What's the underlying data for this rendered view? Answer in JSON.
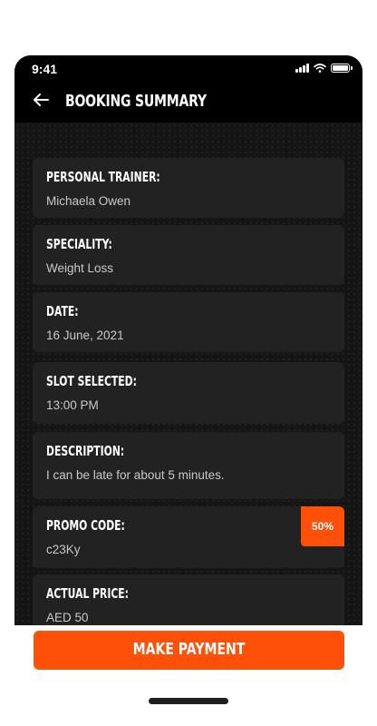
{
  "status_bar": {
    "time": "9:41"
  },
  "header": {
    "title": "BOOKING SUMMARY"
  },
  "summary": [
    {
      "label": "PERSONAL TRAINER:",
      "value": "Michaela Owen"
    },
    {
      "label": "SPECIALITY:",
      "value": "Weight Loss"
    },
    {
      "label": "DATE:",
      "value": "16 June, 2021"
    },
    {
      "label": "SLOT SELECTED:",
      "value": "13:00 PM"
    },
    {
      "label": "DESCRIPTION:",
      "value": "I can be late for about 5 minutes."
    },
    {
      "label": "PROMO CODE:",
      "value": "c23Ky",
      "badge": "50%"
    },
    {
      "label": "ACTUAL PRICE:",
      "value": "AED 50"
    }
  ],
  "actions": {
    "make_payment": "MAKE PAYMENT"
  },
  "colors": {
    "accent": "#fe5009",
    "background": "#151515",
    "card": "#222222"
  },
  "icons": {
    "back": "arrow-left-icon",
    "signal": "signal-icon",
    "wifi": "wifi-icon",
    "battery": "battery-icon"
  }
}
